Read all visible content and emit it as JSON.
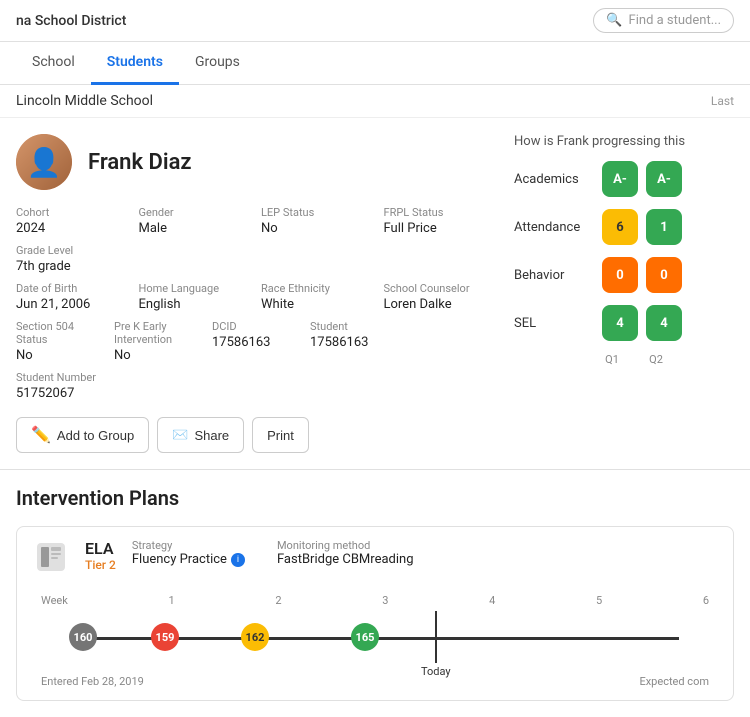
{
  "header": {
    "district_name": "na School District",
    "search_placeholder": "Find a student..."
  },
  "nav": {
    "tabs": [
      "School",
      "Students",
      "Groups"
    ],
    "active_tab": "Students"
  },
  "school_bar": {
    "school_name": "Lincoln Middle School",
    "last_label": "Last"
  },
  "student": {
    "name": "Frank Diaz",
    "cohort_label": "Cohort",
    "cohort_value": "2024",
    "gender_label": "Gender",
    "gender_value": "Male",
    "lep_label": "LEP Status",
    "lep_value": "No",
    "frpl_label": "FRPL Status",
    "frpl_value": "Full Price",
    "grade_label": "Grade Level",
    "grade_value": "7th grade",
    "dob_label": "Date of Birth",
    "dob_value": "Jun 21, 2006",
    "home_lang_label": "Home Language",
    "home_lang_value": "English",
    "race_label": "Race Ethnicity",
    "race_value": "White",
    "counselor_label": "School Counselor",
    "counselor_value": "Loren Dalke",
    "section504_label": "Section 504 Status",
    "section504_value": "No",
    "prek_label": "Pre K Early Intervention",
    "prek_value": "No",
    "dcid_label": "DCID",
    "dcid_value": "17586163",
    "student_id_label": "Student",
    "student_id_value": "17586163",
    "student_num_label": "Student Number",
    "student_num_value": "51752067"
  },
  "actions": {
    "add_group": "Add to Group",
    "share": "Share",
    "print": "Print"
  },
  "progress": {
    "title": "How is Frank progressing this",
    "rows": [
      {
        "label": "Academics",
        "q1_value": "A-",
        "q1_color": "green",
        "q2_value": "A-",
        "q2_color": "green"
      },
      {
        "label": "Attendance",
        "q1_value": "6",
        "q1_color": "yellow",
        "q2_value": "1",
        "q2_color": "green"
      },
      {
        "label": "Behavior",
        "q1_value": "0",
        "q1_color": "orange",
        "q2_value": "0",
        "q2_color": "orange"
      },
      {
        "label": "SEL",
        "q1_value": "4",
        "q1_color": "green",
        "q2_value": "4",
        "q2_color": "green"
      }
    ],
    "q1_label": "Q1",
    "q2_label": "Q2"
  },
  "intervention": {
    "section_title": "Intervention Plans",
    "plan": {
      "subject": "ELA",
      "tier": "Tier 2",
      "strategy_label": "Strategy",
      "strategy_value": "Fluency Practice",
      "monitoring_label": "Monitoring method",
      "monitoring_value": "FastBridge CBMreading",
      "week_label": "Week",
      "timeline_dots": [
        {
          "week": 1,
          "value": "160",
          "color": "gray",
          "position_pct": 0
        },
        {
          "week": 1,
          "value": "159",
          "color": "red",
          "position_pct": 14
        },
        {
          "week": 2,
          "value": "162",
          "color": "yellow",
          "position_pct": 28
        },
        {
          "week": 3,
          "value": "165",
          "color": "green",
          "position_pct": 46
        }
      ],
      "today_position_pct": 57,
      "today_label": "Today",
      "entered_label": "Entered Feb 28, 2019",
      "expected_label": "Expected com"
    }
  }
}
